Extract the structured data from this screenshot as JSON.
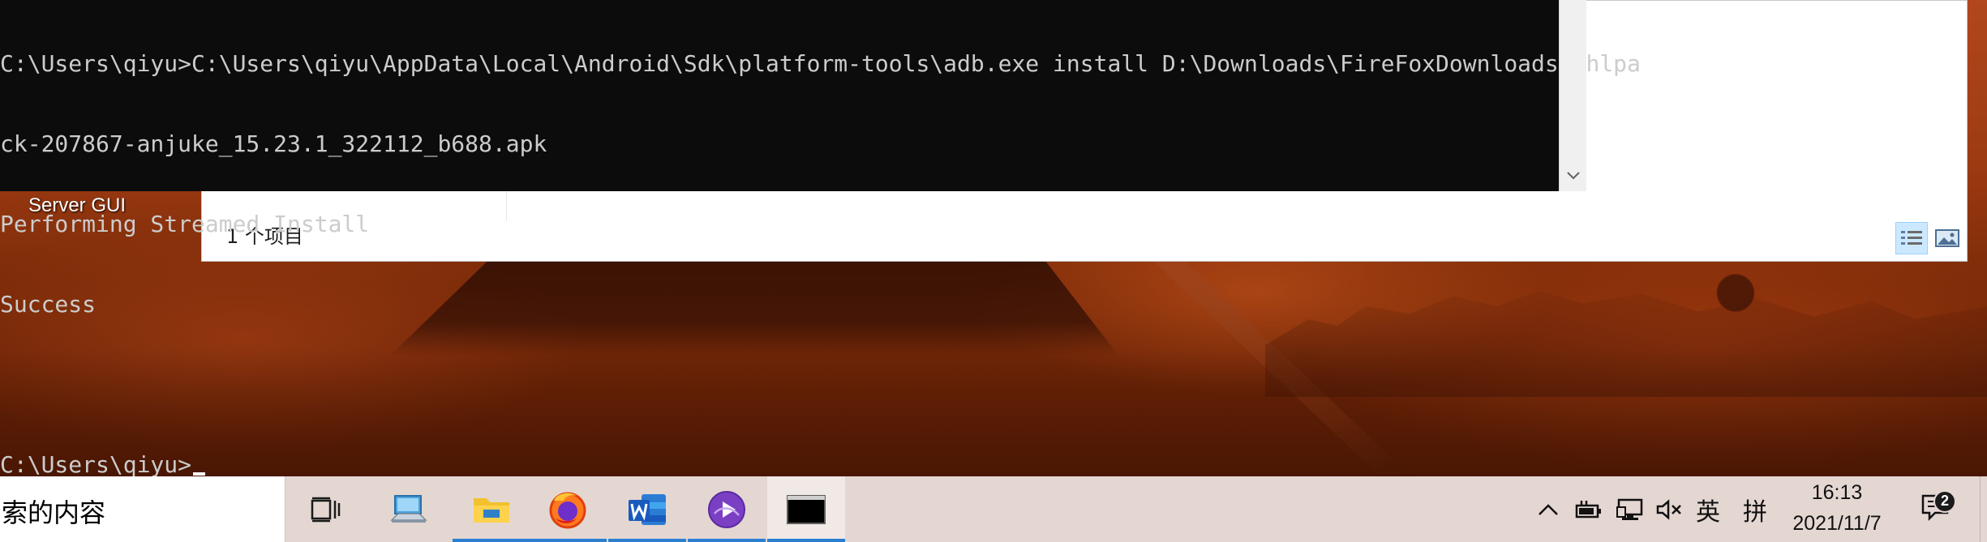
{
  "desktop": {
    "icon_label": "Server GUI"
  },
  "explorer": {
    "status_text": "1 个项目",
    "view_details_icon": "details-view-icon",
    "view_tiles_icon": "large-icons-view-icon"
  },
  "console": {
    "lines": [
      "C:\\Users\\qiyu>C:\\Users\\qiyu\\AppData\\Local\\Android\\Sdk\\platform-tools\\adb.exe install D:\\Downloads\\FireFoxDownloads\\chlpa",
      "ck-207867-anjuke_15.23.1_322112_b688.apk",
      "Performing Streamed Install",
      "Success",
      "",
      "C:\\Users\\qiyu>"
    ]
  },
  "taskbar": {
    "search_text": "索的内容",
    "apps": [
      {
        "name": "task-view",
        "icon": "task-view-icon"
      },
      {
        "name": "this-pc",
        "icon": "computer-icon"
      },
      {
        "name": "file-explorer",
        "icon": "folder-icon",
        "running": true
      },
      {
        "name": "firefox",
        "icon": "firefox-icon",
        "running": true
      },
      {
        "name": "word",
        "icon": "word-icon",
        "running": true
      },
      {
        "name": "media-player",
        "icon": "media-player-icon",
        "running": true
      },
      {
        "name": "command-prompt",
        "icon": "terminal-icon",
        "running": true,
        "active": true
      }
    ],
    "tray": {
      "ime_mode": "英",
      "ime_pinyin": "拼"
    },
    "clock": {
      "time": "16:13",
      "date": "2021/11/7"
    },
    "notification_count": "2"
  },
  "colors": {
    "console_bg": "#0c0c0c",
    "console_fg": "#cccccc",
    "taskbar_bg": "#e4d7d2",
    "accent": "#2b7fd1"
  }
}
